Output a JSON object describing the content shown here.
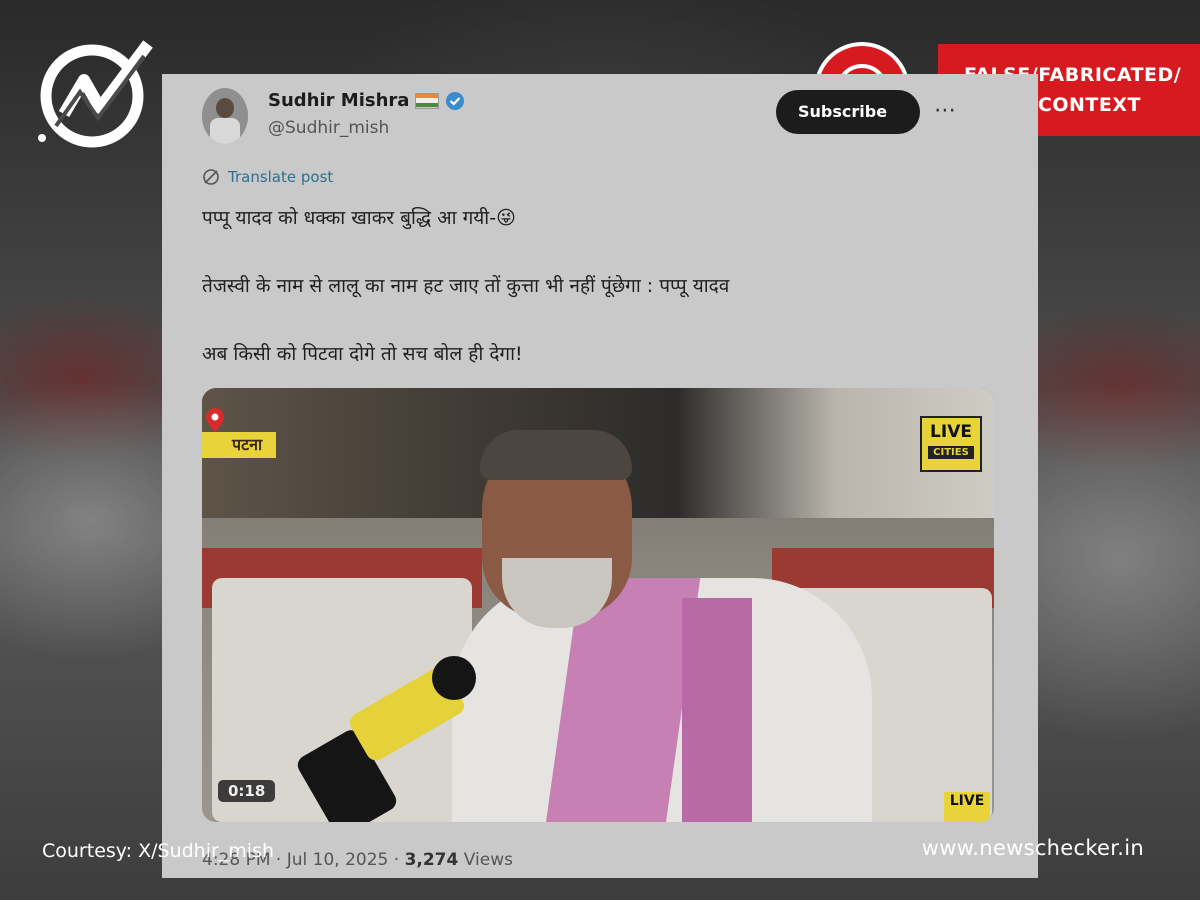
{
  "brand": {
    "logo_icon": "newschecker-check-icon",
    "website": "www.newschecker.in",
    "courtesy": "Courtesy: X/Sudhir_mish"
  },
  "verdict": {
    "icon": "exclamation-icon",
    "line1": "FALSE/FABRICATED/",
    "line2": "FALSE CONTEXT",
    "color": "#d71920"
  },
  "tweet": {
    "author_name": "Sudhir Mishra",
    "author_handle": "@Sudhir_mish",
    "subscribe_label": "Subscribe",
    "translate_label": "Translate post",
    "line1": "पप्पू यादव को धक्का खाकर बुद्धि आ गयी-😜",
    "line2": "तेजस्वी के नाम से लालू का नाम हट जाए तों कुत्ता भी नहीं पूंछेगा : पप्पू यादव",
    "line3": "अब किसी को पिटवा दोगे तो सच बोल ही देगा!",
    "video": {
      "location_tag": "पटना",
      "channel_logo_line1": "LIVE",
      "channel_logo_line2": "CITIES",
      "corner_logo": "LIVE",
      "duration": "0:18"
    },
    "time": "4:28 PM",
    "date": "Jul 10, 2025",
    "views_count": "3,274",
    "views_label": "Views"
  }
}
